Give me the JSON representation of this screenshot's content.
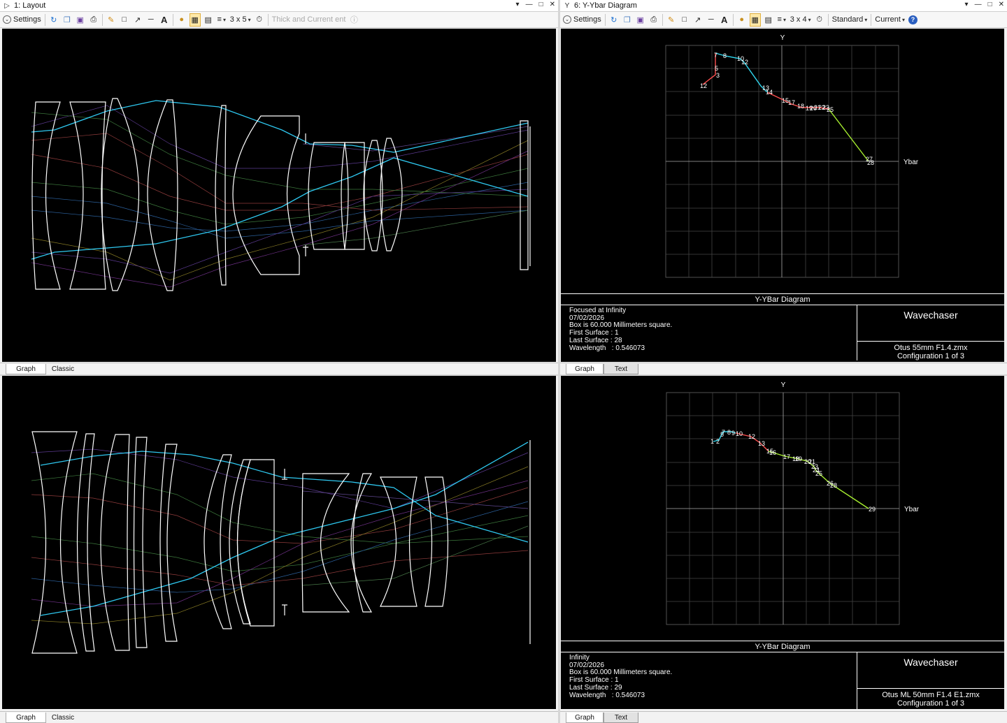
{
  "layout_window": {
    "title": "1: Layout",
    "toolbar": {
      "settings": "Settings",
      "grid": "3 x 5",
      "thick": "Thick",
      "current": "Current",
      "hint": "Thick and Current ent"
    },
    "tabs": [
      "Graph",
      "Classic"
    ]
  },
  "ybar_window": {
    "title": "6: Y-Ybar Diagram",
    "toolbar": {
      "settings": "Settings",
      "grid": "3 x 4",
      "standard": "Standard",
      "current": "Current"
    },
    "tabs": [
      "Graph",
      "Text"
    ]
  },
  "ybar_top": {
    "axis_y": "Y",
    "axis_x": "Ybar",
    "header": "Y-YBar Diagram",
    "info": [
      "Focused at Infinity",
      "07/02/2026",
      "Box is 60.000 Millimeters square.",
      "First Surface : 1",
      "Last Surface : 28",
      "Wavelength   : 0.546073"
    ],
    "brand": "Wavechaser",
    "file": "Otus 55mm F1.4.zmx",
    "config": "Configuration 1 of 3",
    "labels": [
      "12",
      "3",
      "5",
      "7",
      "8",
      "10",
      "12",
      "13",
      "14",
      "15",
      "17",
      "18",
      "19",
      "20",
      "21",
      "22",
      "23",
      "25",
      "27",
      "28"
    ]
  },
  "ybar_bottom": {
    "axis_y": "Y",
    "axis_x": "Ybar",
    "header": "Y-YBar Diagram",
    "info": [
      "Infinity",
      "07/02/2026",
      "Box is 60.000 Millimeters square.",
      "First Surface : 1",
      "Last Surface : 29",
      "Wavelength   : 0.546073"
    ],
    "brand": "Wavechaser",
    "file": "Otus ML 50mm F1.4 E1.zmx",
    "config": "Configuration 1 of 3",
    "labels": [
      "1",
      "2",
      "5",
      "7",
      "8",
      "9",
      "10",
      "12",
      "13",
      "15",
      "16",
      "17",
      "18",
      "19",
      "20",
      "21",
      "23",
      "24",
      "25",
      "26",
      "28",
      "29"
    ]
  },
  "colors": {
    "ray_blue": "#2ec8f0",
    "trace_red": "#ff5050",
    "trace_cyan": "#30d8f0",
    "trace_green": "#a8f030",
    "lens_outline": "#ffffff",
    "background": "#000000",
    "highlight": "#ffe9a8"
  }
}
